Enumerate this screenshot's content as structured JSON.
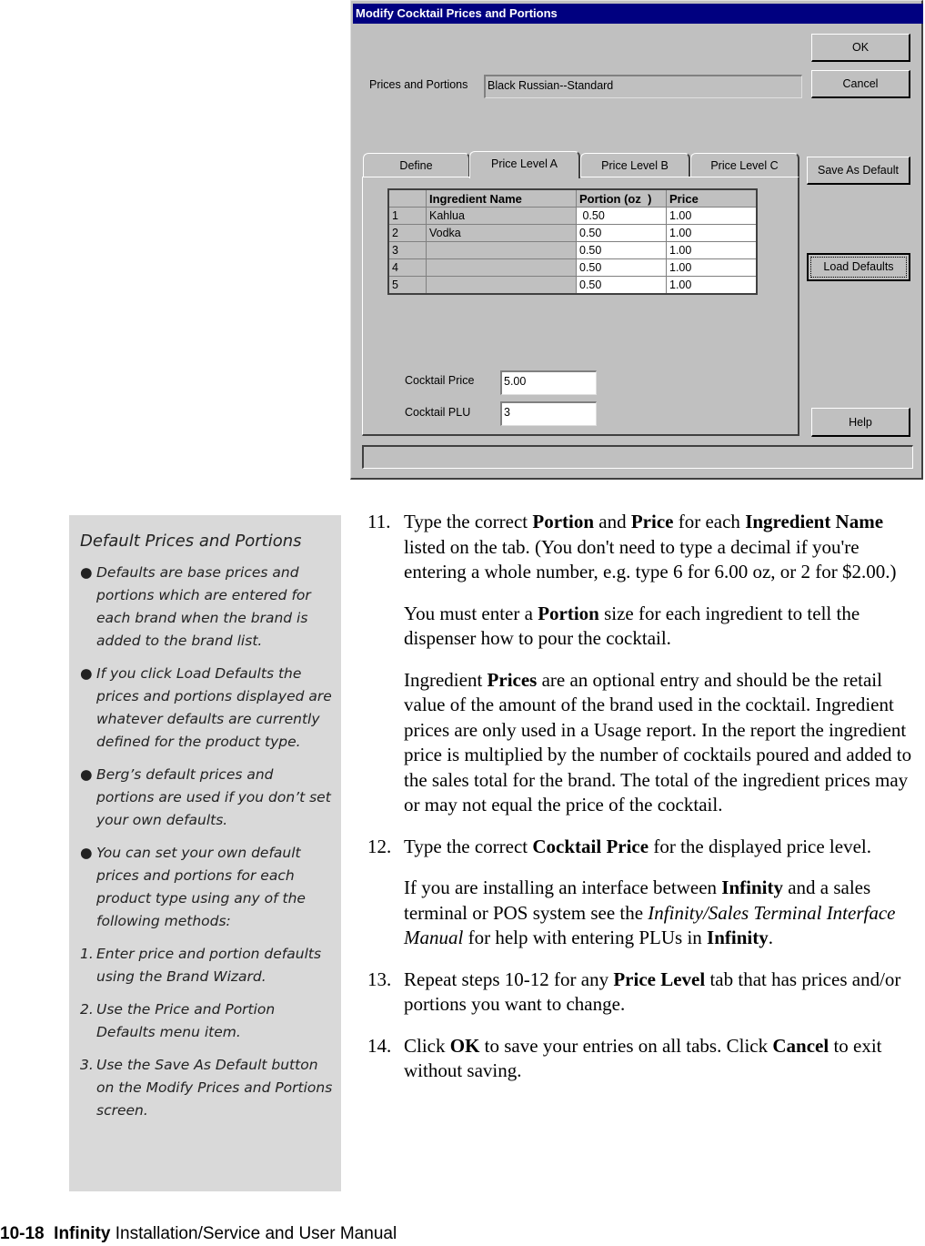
{
  "dialog": {
    "title": "Modify Cocktail Prices and Portions",
    "prices_portions_label": "Prices and Portions",
    "prices_portions_value": "Black Russian--Standard",
    "buttons": {
      "ok": "OK",
      "cancel": "Cancel",
      "save_default": "Save As Default",
      "load_defaults": "Load Defaults",
      "help": "Help"
    },
    "tabs": [
      {
        "label": "Define",
        "active": false
      },
      {
        "label": "Price Level A",
        "active": true
      },
      {
        "label": "Price Level B",
        "active": false
      },
      {
        "label": "Price Level C",
        "active": false
      }
    ],
    "grid": {
      "headers": [
        "",
        "Ingredient Name",
        "Portion (oz  )",
        "Price"
      ],
      "rows": [
        {
          "num": "1",
          "name": "Kahlua",
          "portion": " 0.50",
          "price": "1.00"
        },
        {
          "num": "2",
          "name": "Vodka",
          "portion": "0.50",
          "price": "1.00"
        },
        {
          "num": "3",
          "name": "",
          "portion": "0.50",
          "price": "1.00"
        },
        {
          "num": "4",
          "name": "",
          "portion": "0.50",
          "price": "1.00"
        },
        {
          "num": "5",
          "name": "",
          "portion": "0.50",
          "price": "1.00"
        }
      ]
    },
    "cocktail_price_label": "Cocktail Price",
    "cocktail_price_value": "5.00",
    "cocktail_plu_label": "Cocktail PLU",
    "cocktail_plu_value": "3"
  },
  "note": {
    "title": "Default Prices and Portions",
    "bullets": [
      "Defaults are base prices and portions which are entered for each brand when the brand is added to the brand list.",
      "If you click Load Defaults the prices and portions displayed are whatever defaults are currently defined for the product type.",
      "Berg’s default prices and portions are used if you don’t set your own defaults.",
      "You can set your own default prices and portions for each product type using any of the following methods:"
    ],
    "methods": [
      {
        "n": "1.",
        "text": "Enter price and portion defaults using the Brand Wizard."
      },
      {
        "n": "2.",
        "text": "Use the Price and Portion Defaults menu item."
      },
      {
        "n": "3.",
        "text": "Use the Save As Default button on the Modify Prices and Portions screen."
      }
    ]
  },
  "steps": {
    "s11": {
      "num": "11.",
      "t1": "Type the correct ",
      "b1": "Portion",
      "t2": " and ",
      "b2": "Price",
      "t3": " for each ",
      "b3": "Ingredient Name",
      "t4": " listed on the tab. (You don't need to type a decimal if you're entering a whole number, e.g. type 6 for 6.00 oz, or 2 for $2.00.)",
      "p1a": "You must enter a ",
      "p1b": "Portion",
      "p1c": " size for each ingredient to tell the dispenser how to pour the cocktail.",
      "p2a": "Ingredient ",
      "p2b": "Prices",
      "p2c": " are an optional entry and should be the retail value of the amount of the brand used in the cocktail. Ingredient prices are only used in a Usage report. In the report the ingredient price is multiplied by the number of cocktails poured and added to the sales total for the brand. The total of the ingredient prices may or may not equal the price of the cocktail."
    },
    "s12": {
      "num": "12.",
      "t1": "Type the correct ",
      "b1": "Cocktail Price",
      "t2": " for the displayed price level.",
      "p1a": "If you are installing an interface between ",
      "p1b": "Infinity",
      "p1c": " and a sales terminal or POS system see the ",
      "p1d": "Infinity/Sales Terminal Interface Manual",
      "p1e": " for help with entering PLUs in ",
      "p1f": "Infinity",
      "p1g": "."
    },
    "s13": {
      "num": "13.",
      "t1": "Repeat steps 10-12 for any ",
      "b1": "Price Level",
      "t2": " tab that has prices and/or portions you want to change."
    },
    "s14": {
      "num": "14.",
      "t1": "Click ",
      "b1": "OK",
      "t2": " to save your entries on all tabs. Click ",
      "b2": "Cancel",
      "t3": " to exit without saving."
    }
  },
  "footer": {
    "page": "10-18",
    "product": "Infinity",
    "title": "Installation/Service and User Manual"
  }
}
